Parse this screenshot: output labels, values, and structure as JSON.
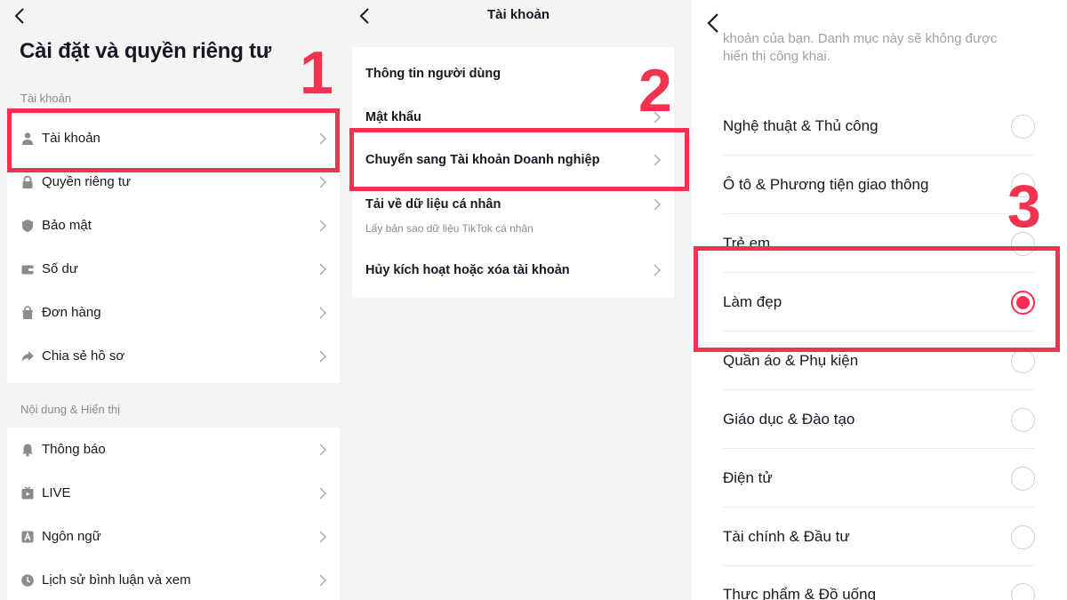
{
  "panel1": {
    "title": "Cài đặt và quyền riêng tư",
    "section_account": "Tài khoản",
    "account_items": [
      {
        "label": "Tài khoản",
        "icon": "person-icon"
      },
      {
        "label": "Quyền riêng tư",
        "icon": "lock-icon"
      },
      {
        "label": "Bảo mật",
        "icon": "shield-icon"
      },
      {
        "label": "Số dư",
        "icon": "wallet-icon"
      },
      {
        "label": "Đơn hàng",
        "icon": "shopping-bag-icon"
      },
      {
        "label": "Chia sẻ hồ sơ",
        "icon": "share-icon"
      }
    ],
    "section_content": "Nội dung & Hiển thị",
    "content_items": [
      {
        "label": "Thông báo",
        "icon": "bell-icon"
      },
      {
        "label": "LIVE",
        "icon": "live-tv-icon"
      },
      {
        "label": "Ngôn ngữ",
        "icon": "language-icon"
      },
      {
        "label": "Lịch sử bình luận và xem",
        "icon": "clock-icon"
      }
    ]
  },
  "panel2": {
    "title": "Tài khoản",
    "items": [
      {
        "label": "Thông tin người dùng"
      },
      {
        "label": "Mật khẩu"
      },
      {
        "label": "Chuyển sang Tài khoản Doanh nghiệp"
      },
      {
        "label": "Tải về dữ liệu cá nhân",
        "sub": "Lấy bản sao dữ liệu TikTok cá nhân"
      },
      {
        "label": "Hủy kích hoạt hoặc xóa tài khoản"
      }
    ]
  },
  "panel3": {
    "desc_line1": "khoản của bạn. Danh mục này sẽ không được",
    "desc_line2": "hiển thị công khai.",
    "options": [
      {
        "label": "Nghệ thuật & Thủ công",
        "selected": false
      },
      {
        "label": "Ô tô & Phương tiện giao thông",
        "selected": false
      },
      {
        "label": "Trẻ em",
        "selected": false
      },
      {
        "label": "Làm đẹp",
        "selected": true
      },
      {
        "label": "Quần áo & Phụ kiện",
        "selected": false
      },
      {
        "label": "Giáo dục & Đào tạo",
        "selected": false
      },
      {
        "label": "Điện tử",
        "selected": false
      },
      {
        "label": "Tài chính & Đầu tư",
        "selected": false
      },
      {
        "label": "Thực phẩm & Đồ uống",
        "selected": false
      }
    ]
  },
  "steps": {
    "one": "1",
    "two": "2",
    "three": "3"
  },
  "colors": {
    "highlight": "#f0334f",
    "accent": "#fe2c55",
    "background": "#f4f4f5",
    "icon": "#8a8b91"
  }
}
